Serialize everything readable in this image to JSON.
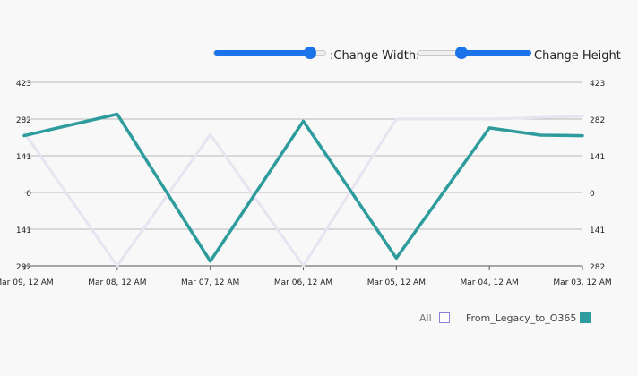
{
  "controls": {
    "width_label": ":Change Width:",
    "height_label": "Change Height",
    "width_slider_value": 0.85,
    "height_slider_value": 0.38
  },
  "legend": {
    "items": [
      {
        "label": "All",
        "color": "#8b7fd6",
        "checked": false
      },
      {
        "label": "From_Legacy_to_O365",
        "color": "#2e9c9c",
        "checked": true
      }
    ]
  },
  "chart_data": {
    "type": "line",
    "x": [
      "Mar 09, 12 AM",
      "Mar 08, 12 AM",
      "Mar 07, 12 AM",
      "Mar 06, 12 AM",
      "Mar 05, 12 AM",
      "Mar 04, 12 AM",
      "Mar 03, 12 AM"
    ],
    "y_ticks_left": [
      "423",
      "282",
      "141",
      "0",
      "141",
      "282"
    ],
    "y_ticks_right": [
      "423",
      "282",
      "141",
      "0",
      "141",
      "282"
    ],
    "ylim": [
      -282,
      423
    ],
    "grid": true,
    "legend_position": "bottom-right",
    "series": [
      {
        "name": "All",
        "color": "#e6e4f0",
        "points": [
          {
            "x": "Mar 09, 12 AM",
            "y": 230
          },
          {
            "x": "Mar 08, 12 AM",
            "y": -282
          },
          {
            "x": "Mar 07, 12 AM",
            "y": 222
          },
          {
            "x": "Mar 06, 12 AM",
            "y": -282
          },
          {
            "x": "Mar 05, 12 AM",
            "y": 282
          },
          {
            "x": "Mar 04, 12 AM",
            "y": 282
          },
          {
            "x": "Mar 03, 12 AM",
            "y": 293
          }
        ]
      },
      {
        "name": "From_Legacy_to_O365",
        "color": "#2e9c9c",
        "points": [
          {
            "x": "Mar 09, 12 AM",
            "y": 218
          },
          {
            "x": "Mar 08, 12 AM",
            "y": 301
          },
          {
            "x": "Mar 07, 12 AM",
            "y": -264
          },
          {
            "x": "Mar 06, 12 AM",
            "y": 274
          },
          {
            "x": "Mar 05, 12 AM",
            "y": -252
          },
          {
            "x": "Mar 04, 12 AM",
            "y": 248
          },
          {
            "x": "Mar 03, 12 AM",
            "y": 220
          },
          {
            "x": "Mar 03, 12 AM",
            "y": 218
          }
        ]
      }
    ]
  }
}
